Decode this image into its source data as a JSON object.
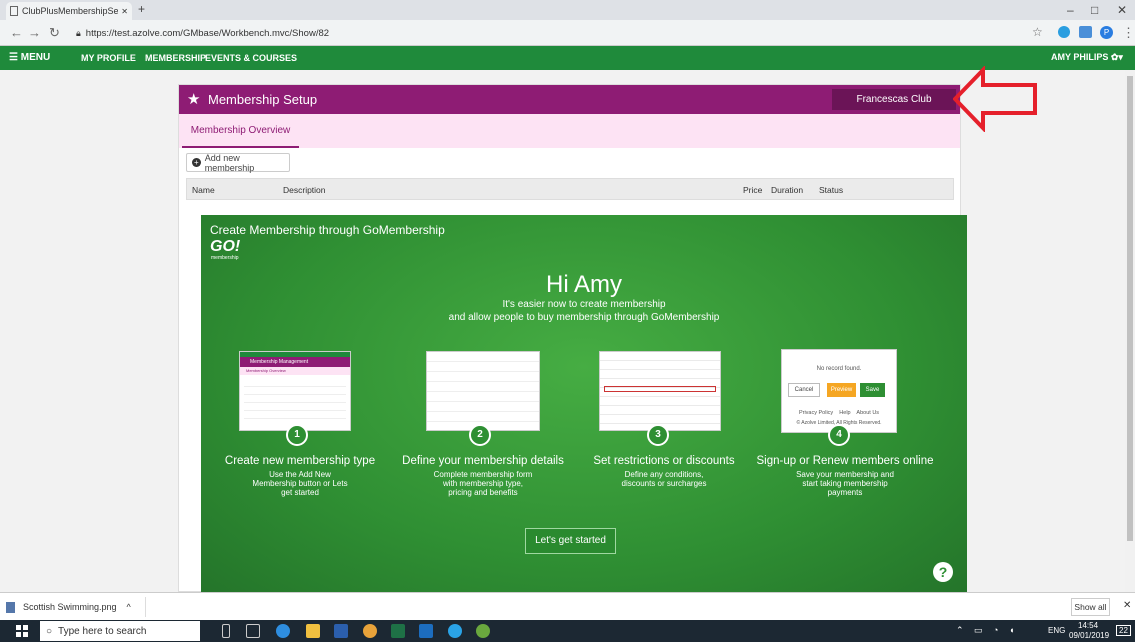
{
  "browser": {
    "tab_title": "ClubPlusMembershipSetup - Goli",
    "tab_close": "✕",
    "new_tab": "+",
    "url": "https://test.azolve.com/GMbase/Workbench.mvc/Show/82",
    "minimize": "–",
    "maximize": "□",
    "close": "✕",
    "ext_badge": "P"
  },
  "appnav": {
    "menu": "☰ MENU",
    "items": [
      "MY PROFILE",
      "MEMBERSHIP",
      "EVENTS & COURSES"
    ],
    "user": "AMY PHILIPS ✿▾"
  },
  "panel": {
    "title": "Membership Setup",
    "club_button": "Francescas Club",
    "tab": "Membership Overview",
    "add_button": "Add new membership",
    "columns": [
      "Name",
      "Description",
      "Price",
      "Duration",
      "Status"
    ]
  },
  "gomembership": {
    "heading": "Create Membership through GoMembership",
    "logo": "GO!",
    "logo_sub": "membership",
    "greeting": "Hi Amy",
    "intro_line1": "It's easier now to create membership",
    "intro_line2": "and allow people to buy membership through GoMembership",
    "steps": [
      {
        "num": "1",
        "title": "Create new membership type",
        "desc": [
          "Use the Add New",
          "Membership button or Lets",
          "get started"
        ]
      },
      {
        "num": "2",
        "title": "Define your membership details",
        "desc": [
          "Complete membership form",
          "with membership type,",
          "pricing and benefits"
        ]
      },
      {
        "num": "3",
        "title": "Set restrictions or discounts",
        "desc": [
          "Define any conditions,",
          "discounts or surcharges"
        ]
      },
      {
        "num": "4",
        "title": "Sign-up or Renew members online",
        "desc": [
          "Save your membership and",
          "start taking membership",
          "payments"
        ]
      }
    ],
    "thumb1": {
      "header": "Membership Management",
      "tab": "Membership Overview"
    },
    "thumb4": {
      "no_record": "No record found.",
      "cancel": "Cancel",
      "preview": "Preview",
      "save": "Save",
      "links": "Privacy Policy    Help    About Us",
      "copyright": "© Azolve Limited, All Rights Reserved."
    },
    "cta": "Let's get started",
    "help": "?"
  },
  "downloads": {
    "file": "Scottish Swimming.png",
    "chevron": "^",
    "show_all": "Show all",
    "close": "✕"
  },
  "taskbar": {
    "search_placeholder": "Type here to search",
    "lang": "ENG",
    "time": "14:54",
    "date": "09/01/2019",
    "notif": "22"
  },
  "colors": {
    "nav_green": "#1f8a3b",
    "header_purple": "#8e1c74",
    "tab_pink": "#fde3f4",
    "go_green": "#2f8f33",
    "arrow_red": "#e5202b",
    "preview_orange": "#f5a623"
  }
}
